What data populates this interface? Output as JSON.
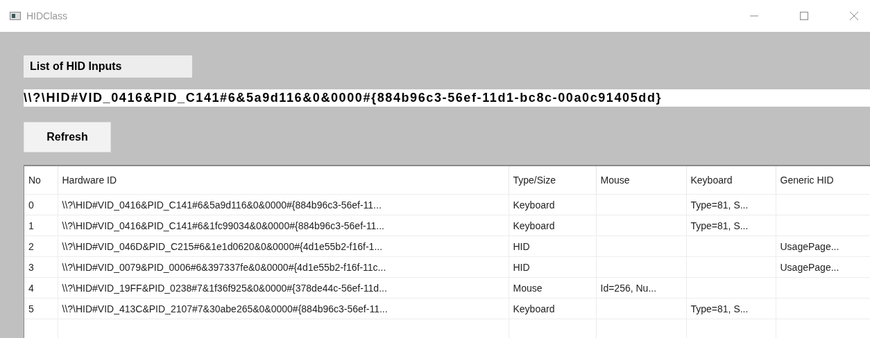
{
  "window": {
    "title": "HIDClass"
  },
  "group_label": "List of HID Inputs",
  "selected_path": "\\\\?\\HID#VID_0416&PID_C141#6&5a9d116&0&0000#{884b96c3-56ef-11d1-bc8c-00a0c91405dd}",
  "refresh_button": "Refresh",
  "table": {
    "columns": [
      "No",
      "Hardware ID",
      "Type/Size",
      "Mouse",
      "Keyboard",
      "Generic HID"
    ],
    "rows": [
      [
        "0",
        "\\\\?\\HID#VID_0416&PID_C141#6&5a9d116&0&0000#{884b96c3-56ef-11...",
        "Keyboard",
        "",
        "Type=81, S...",
        ""
      ],
      [
        "1",
        "\\\\?\\HID#VID_0416&PID_C141#6&1fc99034&0&0000#{884b96c3-56ef-11...",
        "Keyboard",
        "",
        "Type=81, S...",
        ""
      ],
      [
        "2",
        "\\\\?\\HID#VID_046D&PID_C215#6&1e1d0620&0&0000#{4d1e55b2-f16f-1...",
        "HID",
        "",
        "",
        "UsagePage..."
      ],
      [
        "3",
        "\\\\?\\HID#VID_0079&PID_0006#6&397337fe&0&0000#{4d1e55b2-f16f-11c...",
        "HID",
        "",
        "",
        "UsagePage..."
      ],
      [
        "4",
        "\\\\?\\HID#VID_19FF&PID_0238#7&1f36f925&0&0000#{378de44c-56ef-11d...",
        "Mouse",
        "Id=256, Nu...",
        "",
        ""
      ],
      [
        "5",
        "\\\\?\\HID#VID_413C&PID_2107#7&30abe265&0&0000#{884b96c3-56ef-11...",
        "Keyboard",
        "",
        "Type=81, S...",
        ""
      ]
    ]
  }
}
